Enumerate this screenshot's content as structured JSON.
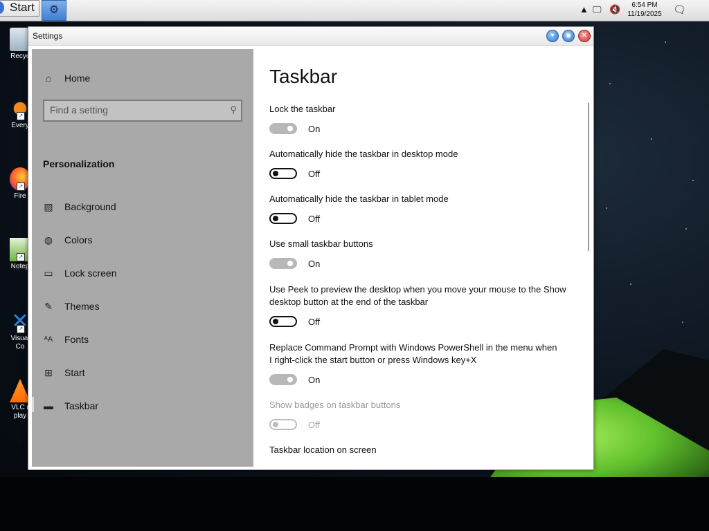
{
  "taskbar": {
    "start_label": "Start",
    "time": "6:54 PM",
    "date": "11/19/2025",
    "tray_icons": [
      "up-arrow-icon",
      "network-icon",
      "volume-muted-icon",
      "notification-icon"
    ]
  },
  "desktop_icons": [
    {
      "label": "Recyc",
      "icon": "recycle-bin-icon"
    },
    {
      "label": "Every",
      "icon": "everything-icon"
    },
    {
      "label": "Fire",
      "icon": "firefox-icon"
    },
    {
      "label": "Notep",
      "icon": "notepad-icon"
    },
    {
      "label": "Visual",
      "label2": "Co",
      "icon": "vscode-icon"
    },
    {
      "label": "VLC r",
      "label2": "play",
      "icon": "vlc-icon"
    }
  ],
  "window": {
    "title": "Settings"
  },
  "sidebar": {
    "home_label": "Home",
    "search_placeholder": "Find a setting",
    "section": "Personalization",
    "items": [
      {
        "label": "Background",
        "icon": "picture-icon"
      },
      {
        "label": "Colors",
        "icon": "palette-icon"
      },
      {
        "label": "Lock screen",
        "icon": "lock-screen-icon"
      },
      {
        "label": "Themes",
        "icon": "themes-icon"
      },
      {
        "label": "Fonts",
        "icon": "fonts-icon"
      },
      {
        "label": "Start",
        "icon": "start-icon"
      },
      {
        "label": "Taskbar",
        "icon": "taskbar-icon"
      }
    ],
    "selected": "Taskbar"
  },
  "main": {
    "title": "Taskbar",
    "settings": [
      {
        "label": "Lock the taskbar",
        "state": "On",
        "on": true,
        "enabled": true
      },
      {
        "label": "Automatically hide the taskbar in desktop mode",
        "state": "Off",
        "on": false,
        "enabled": true
      },
      {
        "label": "Automatically hide the taskbar in tablet mode",
        "state": "Off",
        "on": false,
        "enabled": true
      },
      {
        "label": "Use small taskbar buttons",
        "state": "On",
        "on": true,
        "enabled": true
      },
      {
        "label": "Use Peek to preview the desktop when you move your mouse to the Show desktop button at the end of the taskbar",
        "state": "Off",
        "on": false,
        "enabled": true
      },
      {
        "label": "Replace Command Prompt with Windows PowerShell in the menu when I right-click the start button or press Windows key+X",
        "state": "On",
        "on": true,
        "enabled": true
      },
      {
        "label": "Show badges on taskbar buttons",
        "state": "Off",
        "on": false,
        "enabled": false
      }
    ],
    "location_label": "Taskbar location on screen"
  }
}
